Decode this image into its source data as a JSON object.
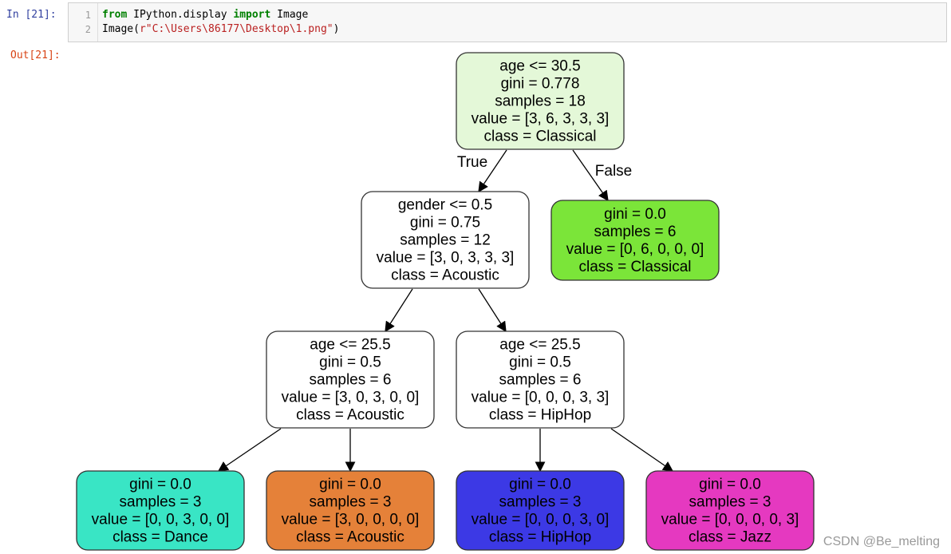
{
  "cell": {
    "in_prompt": "In  [21]:",
    "out_prompt": "Out[21]:",
    "lines": [
      {
        "num": "1",
        "kw1": "from",
        "t1": " IPython.display ",
        "kw2": "import",
        "t2": " Image"
      },
      {
        "num": "2",
        "t0": "Image(",
        "str": "r\"C:\\Users\\86177\\Desktop\\1.png\"",
        "t3": ")"
      }
    ]
  },
  "tree": {
    "edge_labels": {
      "true": "True",
      "false": "False"
    },
    "nodes": [
      {
        "lines": [
          "age <= 30.5",
          "gini = 0.778",
          "samples = 18",
          "value = [3, 6, 3, 3, 3]",
          "class = Classical"
        ],
        "fill": "#e4f8d8"
      },
      {
        "lines": [
          "gender <= 0.5",
          "gini = 0.75",
          "samples = 12",
          "value = [3, 0, 3, 3, 3]",
          "class = Acoustic"
        ],
        "fill": "#ffffff"
      },
      {
        "lines": [
          "gini = 0.0",
          "samples = 6",
          "value = [0, 6, 0, 0, 0]",
          "class = Classical"
        ],
        "fill": "#7be539"
      },
      {
        "lines": [
          "age <= 25.5",
          "gini = 0.5",
          "samples = 6",
          "value = [3, 0, 3, 0, 0]",
          "class = Acoustic"
        ],
        "fill": "#ffffff"
      },
      {
        "lines": [
          "age <= 25.5",
          "gini = 0.5",
          "samples = 6",
          "value = [0, 0, 0, 3, 3]",
          "class = HipHop"
        ],
        "fill": "#ffffff"
      },
      {
        "lines": [
          "gini = 0.0",
          "samples = 3",
          "value = [0, 0, 3, 0, 0]",
          "class = Dance"
        ],
        "fill": "#39e5c5"
      },
      {
        "lines": [
          "gini = 0.0",
          "samples = 3",
          "value = [3, 0, 0, 0, 0]",
          "class = Acoustic"
        ],
        "fill": "#e58139"
      },
      {
        "lines": [
          "gini = 0.0",
          "samples = 3",
          "value = [0, 0, 0, 3, 0]",
          "class = HipHop"
        ],
        "fill": "#3c39e5"
      },
      {
        "lines": [
          "gini = 0.0",
          "samples = 3",
          "value = [0, 0, 0, 0, 3]",
          "class = Jazz"
        ],
        "fill": "#e539c0"
      }
    ]
  },
  "watermark": "CSDN @Be_melting"
}
